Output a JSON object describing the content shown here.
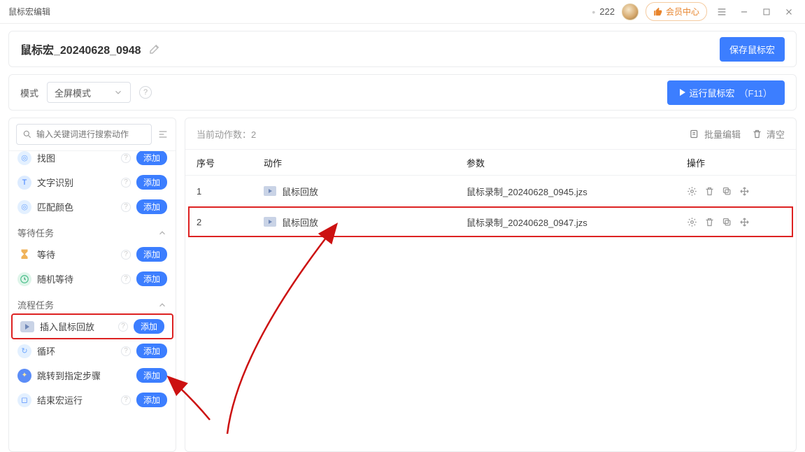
{
  "titlebar": {
    "app_title": "鼠标宏编辑",
    "num": "222",
    "member": "会员中心"
  },
  "header": {
    "macro_name": "鼠标宏_20240628_0948",
    "save": "保存鼠标宏"
  },
  "mode": {
    "label": "模式",
    "value": "全屏模式",
    "run": "运行鼠标宏",
    "hotkey": "（F11）"
  },
  "sidebar": {
    "search_placeholder": "输入关键词进行搜索动作",
    "add": "添加",
    "items_partial": {
      "i0": "找图",
      "i1": "文字识别",
      "i2": "匹配颜色"
    },
    "group_wait": "等待任务",
    "wait_items": {
      "w0": "等待",
      "w1": "随机等待"
    },
    "group_flow": "流程任务",
    "flow_items": {
      "f0": "插入鼠标回放",
      "f1": "循环",
      "f2": "跳转到指定步骤",
      "f3": "结束宏运行"
    }
  },
  "content": {
    "count_label": "当前动作数：",
    "count_value": "2",
    "batch": "批量编辑",
    "clear": "清空",
    "headers": {
      "seq": "序号",
      "act": "动作",
      "par": "参数",
      "ops": "操作"
    },
    "rows": [
      {
        "seq": "1",
        "act": "鼠标回放",
        "par": "鼠标录制_20240628_0945.jzs"
      },
      {
        "seq": "2",
        "act": "鼠标回放",
        "par": "鼠标录制_20240628_0947.jzs"
      }
    ]
  }
}
